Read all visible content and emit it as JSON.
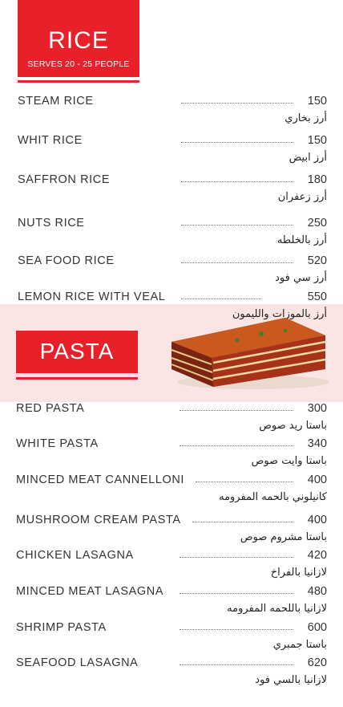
{
  "rice": {
    "title": "RICE",
    "subtitle": "SERVES 20 - 25 PEOPLE",
    "items": [
      {
        "name": "STEAM RICE",
        "price": "150",
        "arabic": "أرز بخاري"
      },
      {
        "name": "WHIT RICE",
        "price": "150",
        "arabic": "أرز ابيض"
      },
      {
        "name": "SAFFRON RICE",
        "price": "180",
        "arabic": "أرز زعفران"
      },
      {
        "name": "NUTS RICE",
        "price": "250",
        "arabic": "أرز بالخلطه"
      },
      {
        "name": "SEA FOOD RICE",
        "price": "520",
        "arabic": "أرز سي فود"
      },
      {
        "name": "LEMON RICE WITH VEAL",
        "price": "550",
        "arabic": "أرز بالموزات والليمون"
      }
    ]
  },
  "pasta": {
    "title": "PASTA",
    "items": [
      {
        "name": "RED PASTA",
        "price": "300",
        "arabic": "باستا ريد صوص"
      },
      {
        "name": "WHITE PASTA",
        "price": "340",
        "arabic": "باستا وايت صوص"
      },
      {
        "name": "MINCED MEAT CANNELLONI",
        "price": "400",
        "arabic": "كانيلوني بالحمه المفرومه"
      },
      {
        "name": "MUSHROOM CREAM PASTA",
        "price": "400",
        "arabic": "باستا مشروم صوص"
      },
      {
        "name": "CHICKEN LASAGNA",
        "price": "420",
        "arabic": "لازانيا بالفراخ"
      },
      {
        "name": "MINCED MEAT LASAGNA",
        "price": "480",
        "arabic": "لازانيا باللحمه المفرومه"
      },
      {
        "name": "SHRIMP PASTA",
        "price": "600",
        "arabic": "باستا جمبري"
      },
      {
        "name": "SEAFOOD LASAGNA",
        "price": "620",
        "arabic": "لازانيا بالسي فود"
      }
    ]
  }
}
